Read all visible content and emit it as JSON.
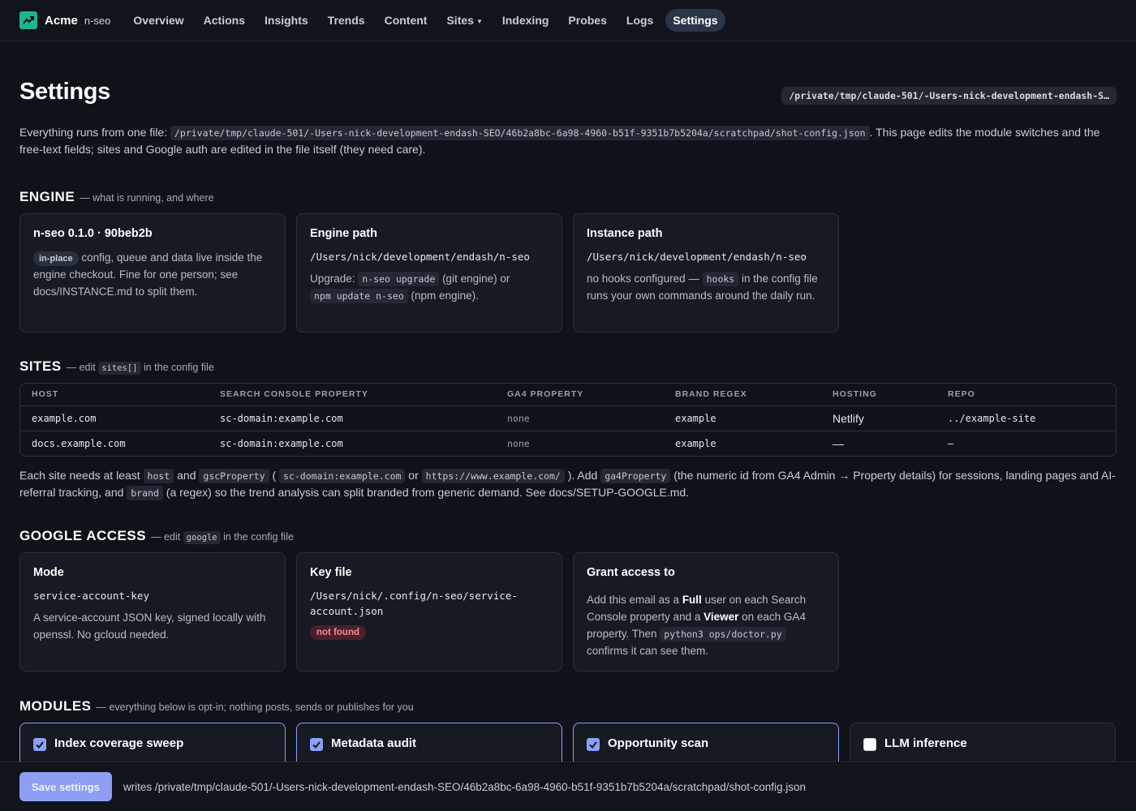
{
  "brand": {
    "name": "Acme",
    "sub": "n-seo"
  },
  "nav": [
    {
      "label": "Overview",
      "active": false
    },
    {
      "label": "Actions",
      "active": false
    },
    {
      "label": "Insights",
      "active": false
    },
    {
      "label": "Trends",
      "active": false
    },
    {
      "label": "Content",
      "active": false
    },
    {
      "label": "Sites",
      "active": false,
      "dropdown": true
    },
    {
      "label": "Indexing",
      "active": false
    },
    {
      "label": "Probes",
      "active": false
    },
    {
      "label": "Logs",
      "active": false
    },
    {
      "label": "Settings",
      "active": true
    }
  ],
  "page": {
    "title": "Settings",
    "config_path_short": "/private/tmp/claude-501/-Users-nick-development-endash-S…",
    "intro_prefix": "Everything runs from one file: ",
    "config_path": "/private/tmp/claude-501/-Users-nick-development-endash-SEO/46b2a8bc-6a98-4960-b51f-9351b7b5204a/scratchpad/shot-config.json",
    "intro_suffix": ". This page edits the module switches and the free-text fields; sites and Google auth are edited in the file itself (they need care)."
  },
  "engine": {
    "title": "ENGINE",
    "sub": "— what is running, and where",
    "version_card": {
      "title": "n-seo 0.1.0 · 90beb2b",
      "tag": "in-place",
      "text": " config, queue and data live inside the engine checkout. Fine for one person; see docs/INSTANCE.md to split them."
    },
    "engine_path_card": {
      "title": "Engine path",
      "path": "/Users/nick/development/endash/n-seo",
      "t1": "Upgrade: ",
      "c1": "n-seo upgrade",
      "t2": " (git engine) or ",
      "c2": "npm update n-seo",
      "t3": " (npm engine)."
    },
    "instance_card": {
      "title": "Instance path",
      "path": "/Users/nick/development/endash/n-seo",
      "t1": "no hooks configured — ",
      "c1": "hooks",
      "t2": " in the config file runs your own commands around the daily run."
    }
  },
  "sites": {
    "title": "SITES",
    "sub_prefix": "— edit ",
    "sub_code": "sites[]",
    "sub_suffix": " in the config file",
    "columns": [
      "HOST",
      "SEARCH CONSOLE PROPERTY",
      "GA4 PROPERTY",
      "BRAND REGEX",
      "HOSTING",
      "REPO"
    ],
    "rows": [
      {
        "host": "example.com",
        "gsc": "sc-domain:example.com",
        "ga4": "none",
        "brand": "example",
        "hosting": "Netlify",
        "repo": "../example-site"
      },
      {
        "host": "docs.example.com",
        "gsc": "sc-domain:example.com",
        "ga4": "none",
        "brand": "example",
        "hosting": "—",
        "repo": "–"
      }
    ],
    "note": {
      "t1": "Each site needs at least ",
      "c1": "host",
      "t2": " and ",
      "c2": "gscProperty",
      "t3": " ( ",
      "c3": "sc-domain:example.com",
      "t4": " or ",
      "c4": "https://www.example.com/",
      "t5": " ). Add ",
      "c5": "ga4Property",
      "t6": " (the numeric id from GA4 Admin → Property details) for sessions, landing pages and AI-referral tracking, and ",
      "c6": "brand",
      "t7": " (a regex) so the trend analysis can split branded from generic demand. See docs/SETUP-GOOGLE.md."
    }
  },
  "google": {
    "title": "GOOGLE ACCESS",
    "sub_prefix": "— edit ",
    "sub_code": "google",
    "sub_suffix": " in the config file",
    "mode_card": {
      "title": "Mode",
      "value": "service-account-key",
      "text": "A service-account JSON key, signed locally with openssl. No gcloud needed."
    },
    "key_card": {
      "title": "Key file",
      "value": "/Users/nick/.config/n-seo/service-account.json",
      "status": "not found"
    },
    "grant_card": {
      "title": "Grant access to",
      "t1": "Add this email as a ",
      "b1": "Full",
      "t2": " user on each Search Console property and a ",
      "b2": "Viewer",
      "t3": " on each GA4 property. Then ",
      "c1": "python3 ops/doctor.py",
      "t4": " confirms it can see them."
    }
  },
  "modules": {
    "title": "MODULES",
    "sub": "— everything below is opt-in; nothing posts, sends or publishes for you",
    "items": [
      {
        "label": "Index coverage sweep",
        "enabled": true
      },
      {
        "label": "Metadata audit",
        "enabled": true
      },
      {
        "label": "Opportunity scan",
        "enabled": true
      },
      {
        "label": "LLM inference",
        "enabled": false
      }
    ]
  },
  "savebar": {
    "button": "Save settings",
    "text": "writes /private/tmp/claude-501/-Users-nick-development-endash-SEO/46b2a8bc-6a98-4960-b51f-9351b7b5204a/scratchpad/shot-config.json"
  },
  "colors": {
    "accent": "#8e9ff3",
    "brand_logo": "#1fb58a",
    "danger": "#f08a9a"
  }
}
